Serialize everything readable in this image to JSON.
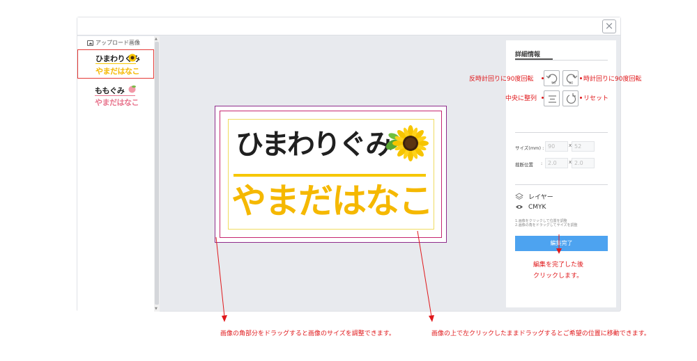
{
  "window": {
    "close_icon": "close-icon",
    "close_glyph": "×"
  },
  "upload_panel": {
    "title": "アップロード画像",
    "title_icon": "image-icon",
    "thumbnails": [
      {
        "top": "ひまわりぐみ",
        "bottom": "やまだはなこ",
        "selected": true,
        "accent": "#f5b800"
      },
      {
        "top": "ももぐみ",
        "bottom": "やまだはなこ",
        "selected": false,
        "accent": "#e8748d"
      }
    ]
  },
  "label": {
    "top_text": "ひまわりぐみ",
    "bottom_text": "やまだはなこ",
    "top_color": "#202020",
    "bottom_color": "#f5b800",
    "icon": "sunflower-icon"
  },
  "details": {
    "title": "詳細情報",
    "buttons": {
      "rotate_ccw": {
        "icon": "rotate-left-icon",
        "degrees": "90"
      },
      "rotate_cw": {
        "icon": "rotate-right-icon",
        "degrees": "90"
      },
      "center": {
        "icon": "align-center-icon"
      },
      "reset": {
        "icon": "reset-icon"
      }
    },
    "size_label": "サイズ(mm) :",
    "size_w": "90",
    "size_h": "52",
    "trim_label": "裁断位置",
    "trim_colon": ":",
    "trim_w": "2.0",
    "trim_h": "2.0",
    "times": "x",
    "layer_label": "レイヤー",
    "layer_icon": "layers-icon",
    "cmyk_label": "CMYK",
    "cmyk_icon": "eye-icon",
    "hint_line1": "1.画像をクリックして位置を調整",
    "hint_line2": "2.画像の角をドラッグしてサイズを調整",
    "finish_button": "編集完了"
  },
  "annotations": {
    "rotate_ccw": "反時計回りに90度回転",
    "rotate_cw": "時計回りに90度回転",
    "center": "中央に整列",
    "reset": "リセット",
    "finish_line1": "編集を完了した後",
    "finish_line2": "クリックします。",
    "resize": "画像の角部分をドラッグすると画像のサイズを調整できます。",
    "move": "画像の上で左クリックしたままドラッグするとご希望の位置に移動できます。",
    "color": "#e0181b"
  }
}
